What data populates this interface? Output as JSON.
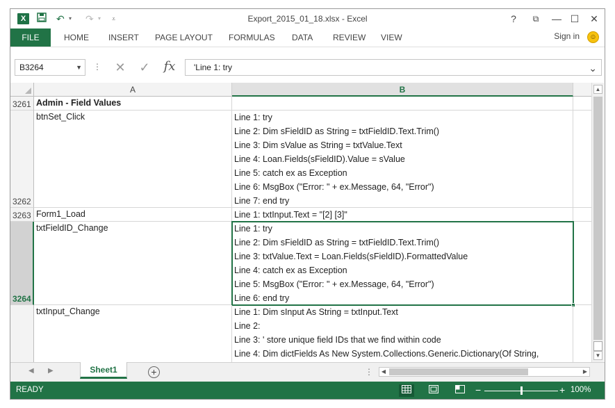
{
  "app": {
    "title": "Export_2015_01_18.xlsx - Excel",
    "logo_letter": "X",
    "icons": [
      "excel-logo-icon",
      "save-icon",
      "undo-icon",
      "redo-icon",
      "customize-qat-icon",
      "help-icon",
      "ribbon-display-icon",
      "minimize-icon",
      "maximize-icon",
      "close-icon"
    ]
  },
  "window_buttons": {
    "help": "?",
    "ribbon_display": "⧉",
    "minimize": "—",
    "maximize": "☐",
    "close": "✕"
  },
  "ribbon": {
    "file_tab": "FILE",
    "tabs": [
      "HOME",
      "INSERT",
      "PAGE LAYOUT",
      "FORMULAS",
      "DATA",
      "REVIEW",
      "VIEW"
    ],
    "sign_in": "Sign in"
  },
  "formula_bar": {
    "name_box": "B3264",
    "fx_label": "fx",
    "content": "'Line 1: try"
  },
  "columns": [
    {
      "label": "A",
      "selected": false
    },
    {
      "label": "B",
      "selected": true
    }
  ],
  "rows": [
    {
      "number": "3261",
      "a": "Admin - Field Values",
      "a_bold": true,
      "b": []
    },
    {
      "number": "3262",
      "a": "btnSet_Click",
      "b": [
        "",
        "Line 1: try",
        "Line 2: Dim sFieldID as String = txtFieldID.Text.Trim()",
        "Line 3: Dim sValue as String = txtValue.Text",
        "Line 4: Loan.Fields(sFieldID).Value = sValue",
        "Line 5: catch ex as Exception",
        "Line 6: MsgBox (\"Error: \" + ex.Message, 64, \"Error\")",
        "Line 7: end try"
      ]
    },
    {
      "number": "3263",
      "a": "Form1_Load",
      "b": [
        "Line 1: txtInput.Text = \"[2] [3]\""
      ]
    },
    {
      "number": "3264",
      "a": "txtFieldID_Change",
      "selected": true,
      "b": [
        "Line 1: try",
        "Line 2: Dim sFieldID as String = txtFieldID.Text.Trim()",
        "Line 3: txtValue.Text = Loan.Fields(sFieldID).FormattedValue",
        "Line 4: catch ex as Exception",
        "Line 5: MsgBox (\"Error: \" + ex.Message, 64, \"Error\")",
        "Line 6: end try"
      ]
    },
    {
      "number": "",
      "a": "txtInput_Change",
      "b": [
        "Line 1: Dim sInput As String = txtInput.Text",
        "Line 2:",
        "Line 3: ' store unique field IDs that we find within code",
        "Line 4: Dim dictFields As New System.Collections.Generic.Dictionary(Of String,"
      ]
    }
  ],
  "sheet_tabs": {
    "active": "Sheet1",
    "add_label": "+"
  },
  "status_bar": {
    "state": "READY",
    "zoom_level": "100%",
    "zoom_fraction": 0.5
  },
  "colors": {
    "accent": "#217346",
    "status_bar": "#217346"
  }
}
